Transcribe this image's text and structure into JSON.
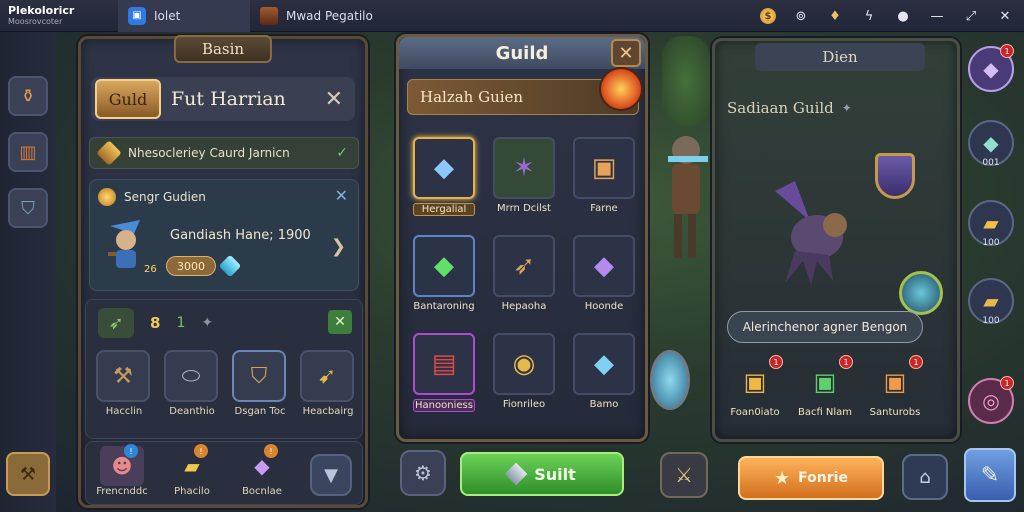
{
  "topbar": {
    "app_title": "Plekoloricr",
    "app_subtitle": "Moosrovcoter",
    "tabs": [
      {
        "label": "Iolet",
        "icon": "app-tile-icon"
      },
      {
        "label": "Mwad Pegatilo",
        "icon": "game-thumbnail-icon"
      }
    ],
    "actions": [
      "coin-icon",
      "target-icon",
      "trophy-icon",
      "bolt-icon",
      "record-icon",
      "minimize-icon",
      "expand-icon",
      "close-icon"
    ]
  },
  "left_panel": {
    "header": "Basin",
    "guild_badge": "Guld",
    "title": "Fut Harrian",
    "row1": "Nhesocleriey Caurd Jarnicn",
    "card": {
      "label": "Sengr Gudien",
      "line": "Gandiash Hane; 1900",
      "amount": "3000",
      "count": "26"
    },
    "stats": {
      "value1": "8",
      "value2": "1"
    },
    "slots": [
      {
        "label": "Hacclin",
        "icon": "hammer-icon"
      },
      {
        "label": "Deanthio",
        "icon": "cannon-icon"
      },
      {
        "label": "Dsgan Toc",
        "icon": "shield-icon"
      },
      {
        "label": "Heacbairg",
        "icon": "spear-icon"
      }
    ],
    "bottom": [
      {
        "label": "Frencnddc",
        "icon": "creature-icon",
        "badge": "!"
      },
      {
        "label": "Phacilo",
        "icon": "gold-bar-icon",
        "badge": "!"
      },
      {
        "label": "Bocnlae",
        "icon": "purple-crystal-icon",
        "badge": "!"
      }
    ]
  },
  "mid_panel": {
    "header": "Guild",
    "subheader": "Halzah Guien",
    "items": [
      {
        "label": "Hergalial",
        "icon": "blue-crystal-icon",
        "selected": true
      },
      {
        "label": "Mrrn Dcilst",
        "icon": "dragon-icon",
        "selected": false
      },
      {
        "label": "Farne",
        "icon": "gift-box-icon",
        "selected": false
      },
      {
        "label": "Bantaroning",
        "icon": "green-crystal-icon",
        "selected": false
      },
      {
        "label": "Hepaoha",
        "icon": "bow-chest-icon",
        "selected": false
      },
      {
        "label": "Hoonde",
        "icon": "purple-gem-icon",
        "selected": false
      },
      {
        "label": "Hanooniess",
        "icon": "red-tome-icon",
        "selected": false
      },
      {
        "label": "Fionrileo",
        "icon": "gold-orb-icon",
        "selected": false
      },
      {
        "label": "Bamo",
        "icon": "ice-crystal-icon",
        "selected": false
      }
    ],
    "action_button": "Suilt"
  },
  "right_panel": {
    "header": "Dien",
    "title": "Sadiaan Guild",
    "banner": "Alerinchenor agner Bengon",
    "items": [
      {
        "label": "Foan0iato",
        "icon": "gold-box-icon",
        "badge": "1"
      },
      {
        "label": "Bacfi Nlam",
        "icon": "green-gift-icon",
        "badge": "1"
      },
      {
        "label": "Santurobs",
        "icon": "orange-chest-icon",
        "badge": "1"
      }
    ],
    "fortune_button": "Fonrie"
  },
  "right_column": [
    {
      "icon": "purple-gem-icon",
      "badge": "1",
      "count": ""
    },
    {
      "icon": "crystal-icon",
      "badge": "",
      "count": "001"
    },
    {
      "icon": "gold-bar-icon",
      "badge": "",
      "count": "100"
    },
    {
      "icon": "gold-ingot-icon",
      "badge": "",
      "count": "100"
    },
    {
      "icon": "portal-icon",
      "badge": "1",
      "count": ""
    }
  ]
}
